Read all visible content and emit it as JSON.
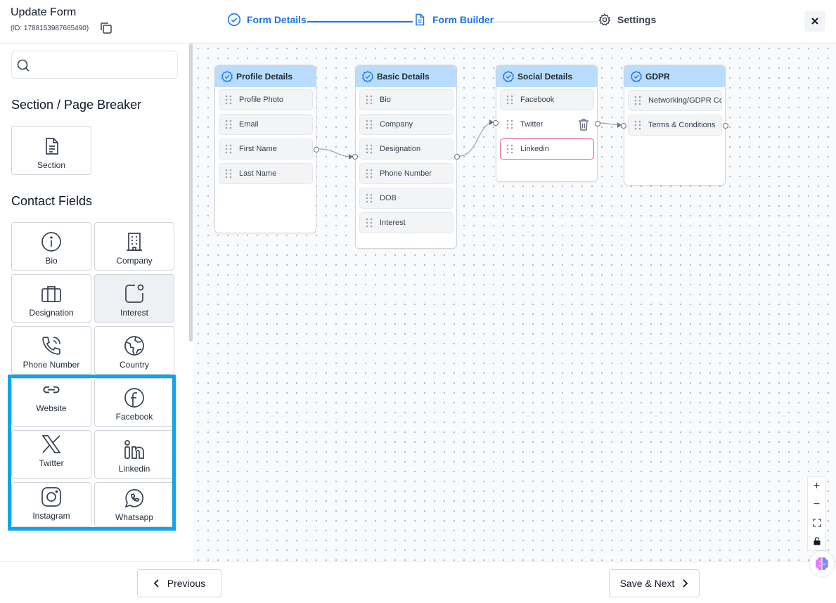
{
  "header": {
    "title": "Update Form",
    "form_id": "(ID: 1788153987665490)",
    "steps": [
      {
        "label": "Form Details"
      },
      {
        "label": "Form Builder"
      },
      {
        "label": "Settings"
      }
    ]
  },
  "sidebar": {
    "search": {
      "placeholder": ""
    },
    "section_heading": "Section / Page Breaker",
    "section_tile": "Section",
    "contact_heading": "Contact Fields",
    "tiles": [
      "Bio",
      "Company",
      "Designation",
      "Interest",
      "Phone Number",
      "Country",
      "Website",
      "Facebook",
      "Twitter",
      "Linkedin",
      "Instagram",
      "Whatsapp"
    ]
  },
  "canvas": {
    "nodes": [
      {
        "title": "Profile Details",
        "fields": [
          "Profile Photo",
          "Email",
          "First Name",
          "Last Name"
        ]
      },
      {
        "title": "Basic Details",
        "fields": [
          "Bio",
          "Company",
          "Designation",
          "Phone Number",
          "DOB",
          "Interest"
        ]
      },
      {
        "title": "Social Details",
        "fields": [
          "Facebook",
          "Twitter",
          "Linkedin"
        ]
      },
      {
        "title": "GDPR",
        "fields": [
          "Networking/GDPR Co",
          "Terms & Conditions"
        ]
      }
    ]
  },
  "footer": {
    "previous": "Previous",
    "save_next": "Save & Next"
  },
  "colors": {
    "accent": "#1a73e8",
    "node_header": "#b9dcff",
    "highlight": "#0ea5e9"
  }
}
